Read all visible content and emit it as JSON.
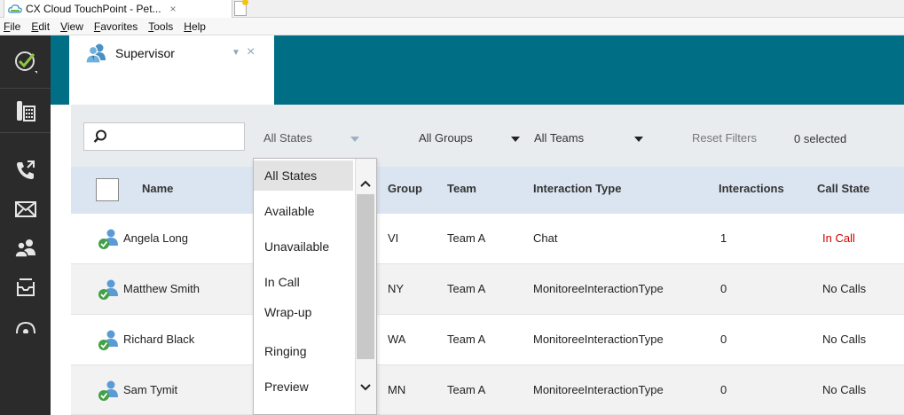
{
  "browser": {
    "tab_title": "CX Cloud TouchPoint - Pet...",
    "tab_close": "×"
  },
  "menu": [
    "File",
    "Edit",
    "View",
    "Favorites",
    "Tools",
    "Help"
  ],
  "app": {
    "tab_label": "Supervisor",
    "tab_close": "×",
    "accent_color": "#006e85",
    "rail_color": "#2b2b2b"
  },
  "filters": {
    "states_label": "All States",
    "groups_label": "All Groups",
    "teams_label": "All Teams",
    "reset_label": "Reset Filters",
    "selected_label": "0 selected"
  },
  "table": {
    "headers": {
      "name": "Name",
      "group": "Group",
      "team": "Team",
      "interaction_type": "Interaction Type",
      "interactions": "Interactions",
      "call_state": "Call State"
    },
    "rows": [
      {
        "name": "Angela Long",
        "group": "VI",
        "team": "Team A",
        "interaction_type": "Chat",
        "interactions": "1",
        "call_state": "In Call"
      },
      {
        "name": "Matthew Smith",
        "group": "NY",
        "team": "Team A",
        "interaction_type": "MonitoreeInteractionType",
        "interactions": "0",
        "call_state": "No Calls"
      },
      {
        "name": "Richard Black",
        "group": "WA",
        "team": "Team A",
        "interaction_type": "MonitoreeInteractionType",
        "interactions": "0",
        "call_state": "No Calls"
      },
      {
        "name": "Sam Tymit",
        "group": "MN",
        "team": "Team A",
        "interaction_type": "MonitoreeInteractionType",
        "interactions": "0",
        "call_state": "No Calls"
      }
    ]
  },
  "dropdown": {
    "options": [
      "All States",
      "Available",
      "Unavailable",
      "In Call",
      "Wrap-up",
      "Ringing",
      "Preview"
    ],
    "selected": "All States"
  },
  "icons": {
    "ready": "check-circle-icon",
    "phone_pad": "phone-keypad-icon",
    "call": "phone-call-icon",
    "email": "envelope-icon",
    "supervisor": "people-icon",
    "inbox": "inbox-icon"
  }
}
